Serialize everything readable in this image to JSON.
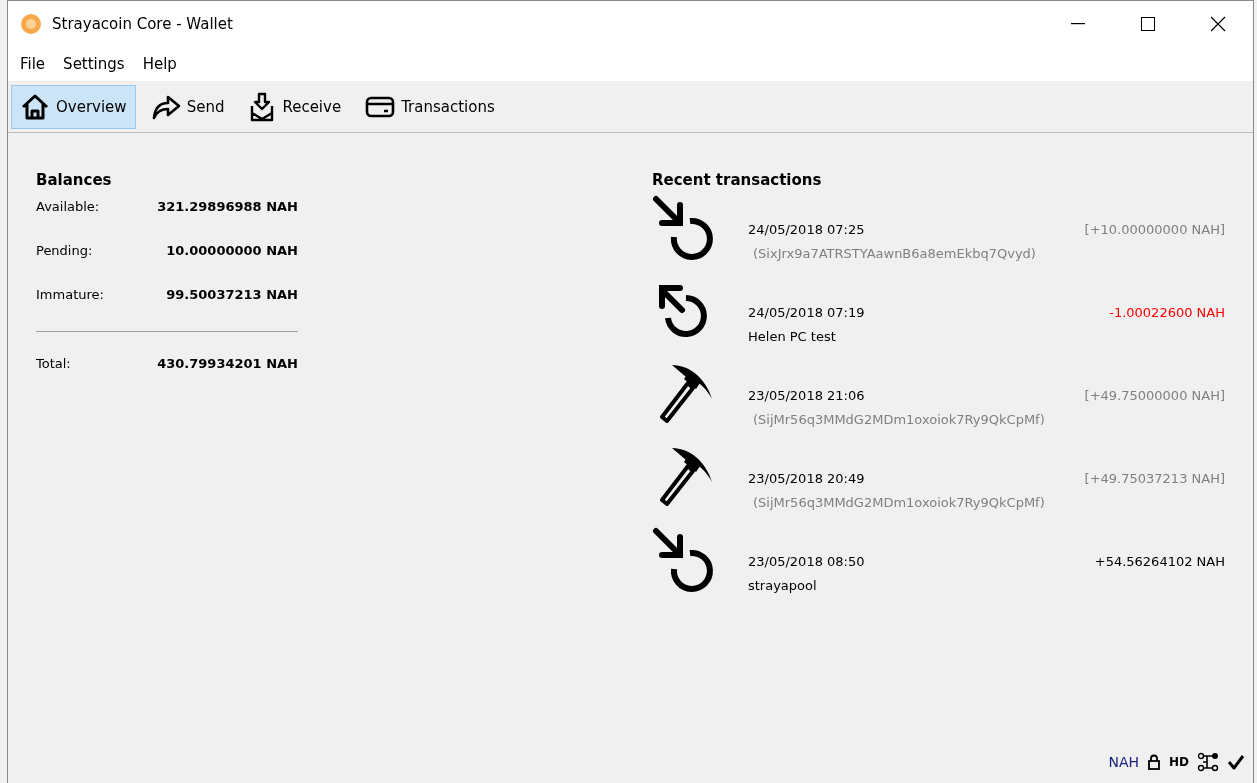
{
  "window": {
    "title": "Strayacoin Core - Wallet"
  },
  "menu": [
    "File",
    "Settings",
    "Help"
  ],
  "toolbar": [
    {
      "kind": "home",
      "label": "Overview",
      "selected": true
    },
    {
      "kind": "send",
      "label": "Send",
      "selected": false
    },
    {
      "kind": "receive",
      "label": "Receive",
      "selected": false
    },
    {
      "kind": "card",
      "label": "Transactions",
      "selected": false
    }
  ],
  "balances": {
    "title": "Balances",
    "rows": [
      {
        "label": "Available:",
        "value": "321.29896988 NAH"
      },
      {
        "label": "Pending:",
        "value": "10.00000000 NAH"
      },
      {
        "label": "Immature:",
        "value": "99.50037213 NAH"
      }
    ],
    "total": {
      "label": "Total:",
      "value": "430.79934201 NAH"
    }
  },
  "recent": {
    "title": "Recent transactions",
    "items": [
      {
        "kind": "incoming",
        "date": "24/05/2018 07:25",
        "amount": {
          "text": "[+10.00000000 NAH]",
          "kind": "unconfirmed"
        },
        "detail": {
          "text": "(SixJrx9a7ATRSTYAawnB6a8emEkbq7Qvyd)",
          "kind": "address"
        }
      },
      {
        "kind": "outgoing",
        "date": "24/05/2018 07:19",
        "amount": {
          "text": "-1.00022600 NAH",
          "kind": "debit"
        },
        "detail": {
          "text": "Helen PC test",
          "kind": "label"
        }
      },
      {
        "kind": "mined",
        "date": "23/05/2018 21:06",
        "amount": {
          "text": "[+49.75000000 NAH]",
          "kind": "unconfirmed"
        },
        "detail": {
          "text": "(SijMr56q3MMdG2MDm1oxoiok7Ry9QkCpMf)",
          "kind": "address"
        }
      },
      {
        "kind": "mined",
        "date": "23/05/2018 20:49",
        "amount": {
          "text": "[+49.75037213 NAH]",
          "kind": "unconfirmed"
        },
        "detail": {
          "text": "(SijMr56q3MMdG2MDm1oxoiok7Ry9QkCpMf)",
          "kind": "address"
        }
      },
      {
        "kind": "incoming",
        "date": "23/05/2018 08:50",
        "amount": {
          "text": "+54.56264102 NAH",
          "kind": "credit"
        },
        "detail": {
          "text": "strayapool",
          "kind": "label"
        }
      }
    ]
  },
  "status_bar": {
    "unit": "NAH",
    "hd": "HD"
  }
}
